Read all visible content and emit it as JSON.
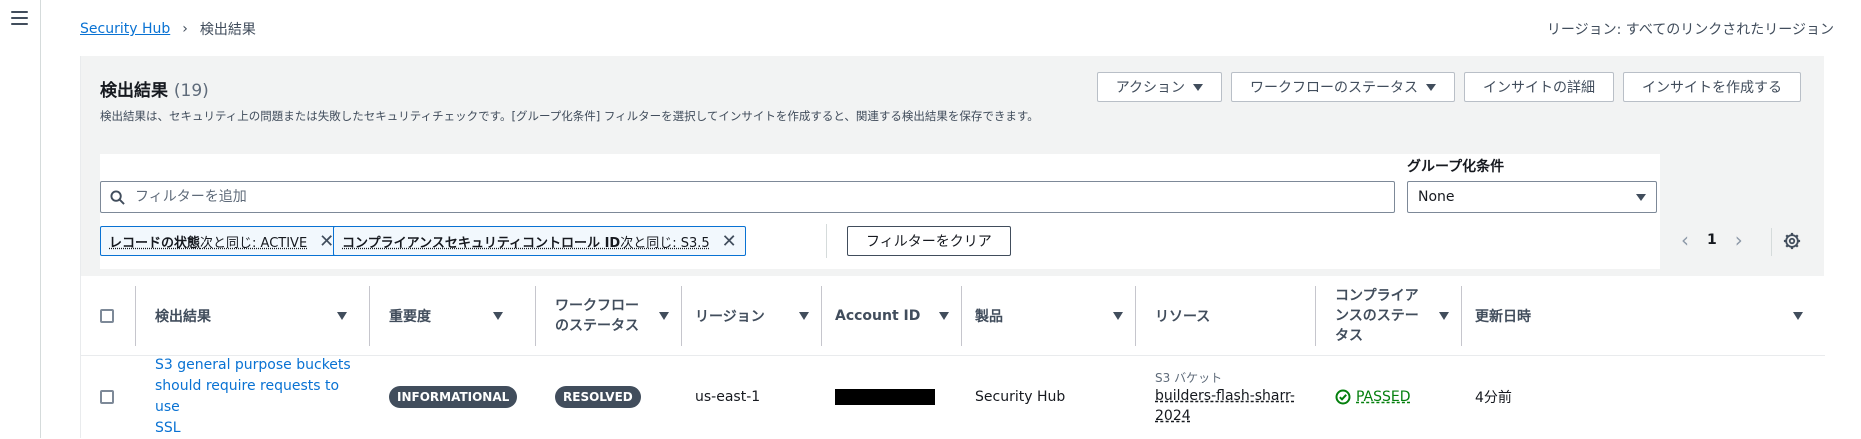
{
  "breadcrumb": {
    "parent": "Security Hub",
    "current": "検出結果"
  },
  "region_label": "リージョン: すべてのリンクされたリージョン",
  "header": {
    "title": "検出結果",
    "count": "(19)",
    "description": "検出結果は、セキュリティ上の問題または失敗したセキュリティチェックです。[グループ化条件] フィルターを選択してインサイトを作成すると、関連する検出結果を保存できます。"
  },
  "buttons": {
    "actions": "アクション",
    "workflow_status": "ワークフローのステータス",
    "insight_details": "インサイトの詳細",
    "create_insight": "インサイトを作成する",
    "clear_filters": "フィルターをクリア"
  },
  "search": {
    "placeholder": "フィルターを追加"
  },
  "grouping": {
    "label": "グループ化条件",
    "selected": "None"
  },
  "tokens": [
    {
      "property": "レコードの状態",
      "text": " 次と同じ: ACTIVE"
    },
    {
      "property": "コンプライアンスセキュリティコントロール ID",
      "text": " 次と同じ: S3.5"
    }
  ],
  "pager": {
    "page": "1"
  },
  "columns": {
    "finding": "検出結果",
    "severity": "重要度",
    "workflow_line1": "ワークフロー",
    "workflow_line2": "のステータス",
    "region": "リージョン",
    "account": "Account ID",
    "product": "製品",
    "resource": "リソース",
    "compliance_line1": "コンプライア",
    "compliance_line2": "ンスのステー",
    "compliance_line3": "タス",
    "updated": "更新日時"
  },
  "rows": [
    {
      "finding_line1": "S3 general purpose buckets",
      "finding_line2": "should require requests to use",
      "finding_line3": "SSL",
      "severity": "INFORMATIONAL",
      "workflow": "RESOLVED",
      "region": "us-east-1",
      "product": "Security Hub",
      "resource_type": "S3 バケット",
      "resource_line1": "builders-flash-sharr-",
      "resource_line2": "2024",
      "compliance": "PASSED",
      "updated": "4分前"
    }
  ]
}
